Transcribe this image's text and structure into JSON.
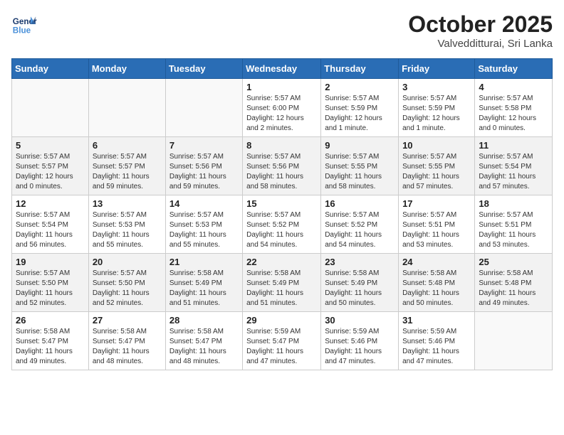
{
  "header": {
    "logo_line1": "General",
    "logo_line2": "Blue",
    "month": "October 2025",
    "location": "Valvedditturai, Sri Lanka"
  },
  "weekdays": [
    "Sunday",
    "Monday",
    "Tuesday",
    "Wednesday",
    "Thursday",
    "Friday",
    "Saturday"
  ],
  "weeks": [
    [
      {
        "day": "",
        "info": ""
      },
      {
        "day": "",
        "info": ""
      },
      {
        "day": "",
        "info": ""
      },
      {
        "day": "1",
        "info": "Sunrise: 5:57 AM\nSunset: 6:00 PM\nDaylight: 12 hours\nand 2 minutes."
      },
      {
        "day": "2",
        "info": "Sunrise: 5:57 AM\nSunset: 5:59 PM\nDaylight: 12 hours\nand 1 minute."
      },
      {
        "day": "3",
        "info": "Sunrise: 5:57 AM\nSunset: 5:59 PM\nDaylight: 12 hours\nand 1 minute."
      },
      {
        "day": "4",
        "info": "Sunrise: 5:57 AM\nSunset: 5:58 PM\nDaylight: 12 hours\nand 0 minutes."
      }
    ],
    [
      {
        "day": "5",
        "info": "Sunrise: 5:57 AM\nSunset: 5:57 PM\nDaylight: 12 hours\nand 0 minutes."
      },
      {
        "day": "6",
        "info": "Sunrise: 5:57 AM\nSunset: 5:57 PM\nDaylight: 11 hours\nand 59 minutes."
      },
      {
        "day": "7",
        "info": "Sunrise: 5:57 AM\nSunset: 5:56 PM\nDaylight: 11 hours\nand 59 minutes."
      },
      {
        "day": "8",
        "info": "Sunrise: 5:57 AM\nSunset: 5:56 PM\nDaylight: 11 hours\nand 58 minutes."
      },
      {
        "day": "9",
        "info": "Sunrise: 5:57 AM\nSunset: 5:55 PM\nDaylight: 11 hours\nand 58 minutes."
      },
      {
        "day": "10",
        "info": "Sunrise: 5:57 AM\nSunset: 5:55 PM\nDaylight: 11 hours\nand 57 minutes."
      },
      {
        "day": "11",
        "info": "Sunrise: 5:57 AM\nSunset: 5:54 PM\nDaylight: 11 hours\nand 57 minutes."
      }
    ],
    [
      {
        "day": "12",
        "info": "Sunrise: 5:57 AM\nSunset: 5:54 PM\nDaylight: 11 hours\nand 56 minutes."
      },
      {
        "day": "13",
        "info": "Sunrise: 5:57 AM\nSunset: 5:53 PM\nDaylight: 11 hours\nand 55 minutes."
      },
      {
        "day": "14",
        "info": "Sunrise: 5:57 AM\nSunset: 5:53 PM\nDaylight: 11 hours\nand 55 minutes."
      },
      {
        "day": "15",
        "info": "Sunrise: 5:57 AM\nSunset: 5:52 PM\nDaylight: 11 hours\nand 54 minutes."
      },
      {
        "day": "16",
        "info": "Sunrise: 5:57 AM\nSunset: 5:52 PM\nDaylight: 11 hours\nand 54 minutes."
      },
      {
        "day": "17",
        "info": "Sunrise: 5:57 AM\nSunset: 5:51 PM\nDaylight: 11 hours\nand 53 minutes."
      },
      {
        "day": "18",
        "info": "Sunrise: 5:57 AM\nSunset: 5:51 PM\nDaylight: 11 hours\nand 53 minutes."
      }
    ],
    [
      {
        "day": "19",
        "info": "Sunrise: 5:57 AM\nSunset: 5:50 PM\nDaylight: 11 hours\nand 52 minutes."
      },
      {
        "day": "20",
        "info": "Sunrise: 5:57 AM\nSunset: 5:50 PM\nDaylight: 11 hours\nand 52 minutes."
      },
      {
        "day": "21",
        "info": "Sunrise: 5:58 AM\nSunset: 5:49 PM\nDaylight: 11 hours\nand 51 minutes."
      },
      {
        "day": "22",
        "info": "Sunrise: 5:58 AM\nSunset: 5:49 PM\nDaylight: 11 hours\nand 51 minutes."
      },
      {
        "day": "23",
        "info": "Sunrise: 5:58 AM\nSunset: 5:49 PM\nDaylight: 11 hours\nand 50 minutes."
      },
      {
        "day": "24",
        "info": "Sunrise: 5:58 AM\nSunset: 5:48 PM\nDaylight: 11 hours\nand 50 minutes."
      },
      {
        "day": "25",
        "info": "Sunrise: 5:58 AM\nSunset: 5:48 PM\nDaylight: 11 hours\nand 49 minutes."
      }
    ],
    [
      {
        "day": "26",
        "info": "Sunrise: 5:58 AM\nSunset: 5:47 PM\nDaylight: 11 hours\nand 49 minutes."
      },
      {
        "day": "27",
        "info": "Sunrise: 5:58 AM\nSunset: 5:47 PM\nDaylight: 11 hours\nand 48 minutes."
      },
      {
        "day": "28",
        "info": "Sunrise: 5:58 AM\nSunset: 5:47 PM\nDaylight: 11 hours\nand 48 minutes."
      },
      {
        "day": "29",
        "info": "Sunrise: 5:59 AM\nSunset: 5:47 PM\nDaylight: 11 hours\nand 47 minutes."
      },
      {
        "day": "30",
        "info": "Sunrise: 5:59 AM\nSunset: 5:46 PM\nDaylight: 11 hours\nand 47 minutes."
      },
      {
        "day": "31",
        "info": "Sunrise: 5:59 AM\nSunset: 5:46 PM\nDaylight: 11 hours\nand 47 minutes."
      },
      {
        "day": "",
        "info": ""
      }
    ]
  ]
}
